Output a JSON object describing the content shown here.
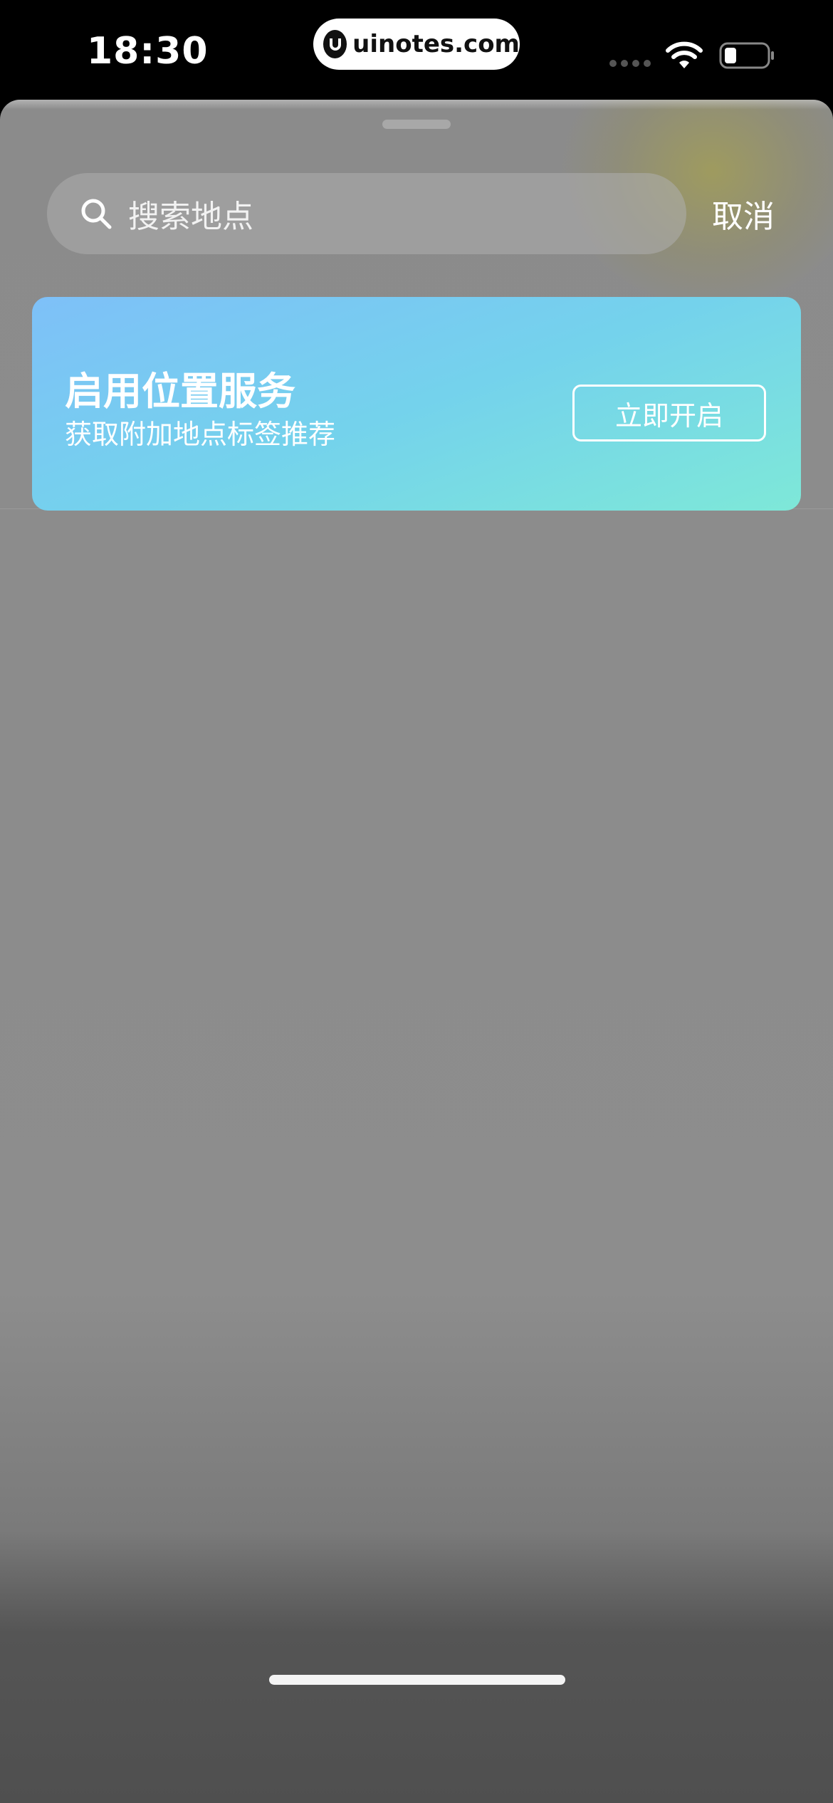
{
  "status_bar": {
    "time": "18:30",
    "watermark": "uinotes.com"
  },
  "sheet": {
    "search": {
      "placeholder": "搜索地点",
      "icon": "search-icon"
    },
    "cancel_label": "取消"
  },
  "location_banner": {
    "title": "启用位置服务",
    "subtitle": "获取附加地点标签推荐",
    "button_label": "立即开启",
    "gradient_start": "#7ec0f8",
    "gradient_end": "#7ee8d8"
  },
  "colors": {
    "sheet_background": "#8b8b8b",
    "status_bar_background": "#000000"
  }
}
